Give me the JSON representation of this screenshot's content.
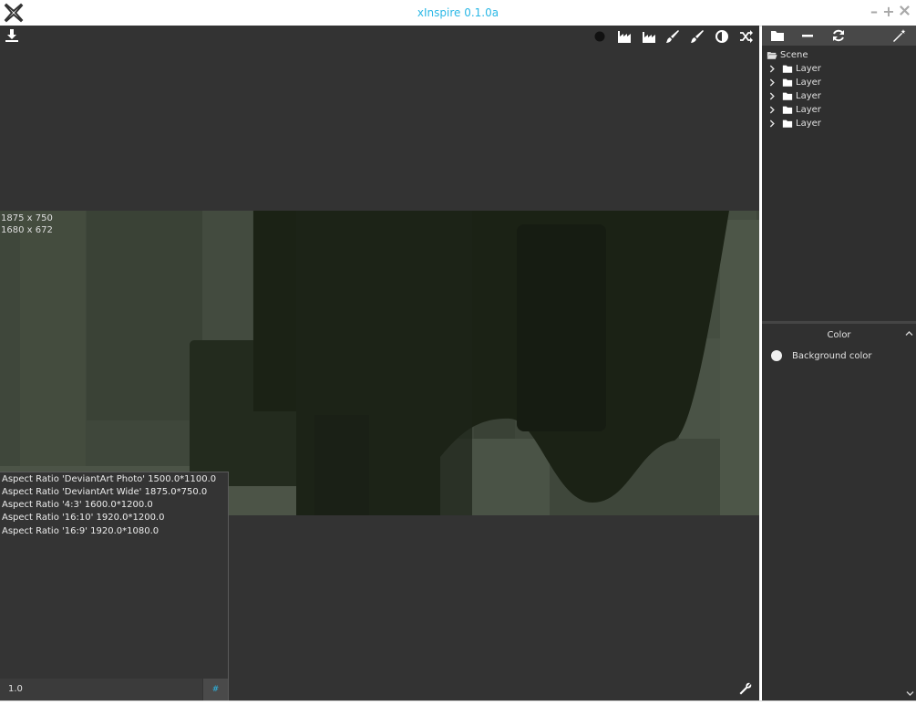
{
  "window": {
    "title": "xInspire 0.1.0a",
    "minimize": "–",
    "maximize": "+"
  },
  "canvas": {
    "toolbar_icons": [
      "dot-icon",
      "factory-icon",
      "factory-alt-icon",
      "brush-icon",
      "brush-alt-icon",
      "contrast-icon",
      "shuffle-icon"
    ],
    "size_labels": [
      "1875 x 750",
      "1680 x 672"
    ]
  },
  "aspect_panel": {
    "items": [
      "Aspect Ratio 'DeviantArt Photo' 1500.0*1100.0",
      "Aspect Ratio 'DeviantArt Wide' 1875.0*750.0",
      "Aspect Ratio '4:3' 1600.0*1200.0",
      "Aspect Ratio '16:10' 1920.0*1200.0",
      "Aspect Ratio '16:9' 1920.0*1080.0"
    ],
    "input_value": "1.0",
    "hash_label": "#"
  },
  "scene_tree": {
    "root": "Scene",
    "layers": [
      "Layer",
      "Layer",
      "Layer",
      "Layer",
      "Layer"
    ]
  },
  "properties": {
    "section_title": "Color",
    "background_color_label": "Background color",
    "background_color": "#f0f0f0"
  },
  "colors": {
    "accent": "#2bb8e6",
    "panel": "#333333",
    "stage": "#3f473b"
  }
}
